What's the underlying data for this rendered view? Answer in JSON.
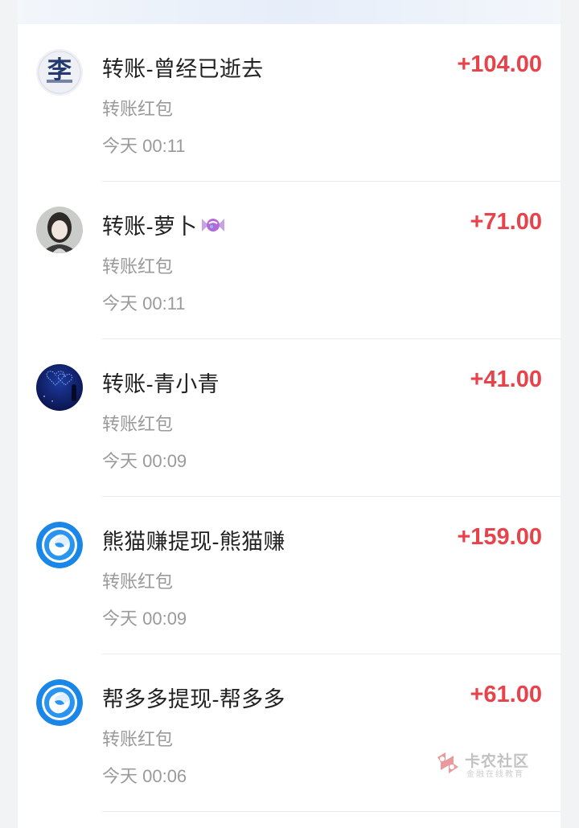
{
  "transactions": [
    {
      "title": "转账-曾经已逝去",
      "amount": "+104.00",
      "subtitle": "转账红包",
      "time": "今天 00:11",
      "avatar_icon": "li-character-avatar"
    },
    {
      "title": "转账-萝卜",
      "amount": "+71.00",
      "subtitle": "转账红包",
      "time": "今天 00:11",
      "avatar_icon": "girl-photo-avatar",
      "title_emoji": "candy-icon"
    },
    {
      "title": "转账-青小青",
      "amount": "+41.00",
      "subtitle": "转账红包",
      "time": "今天 00:09",
      "avatar_icon": "night-sky-avatar"
    },
    {
      "title": "熊猫赚提现-熊猫赚",
      "amount": "+159.00",
      "subtitle": "转账红包",
      "time": "今天 00:09",
      "avatar_icon": "blue-swirl-logo"
    },
    {
      "title": "帮多多提现-帮多多",
      "amount": "+61.00",
      "subtitle": "转账红包",
      "time": "今天 00:06",
      "avatar_icon": "blue-swirl-logo"
    }
  ],
  "watermark": {
    "title": "卡农社区",
    "subtitle": "金融在线教育"
  },
  "colors": {
    "amount": "#e8424b",
    "primary_text": "#222222",
    "secondary_text": "#9a9a9a",
    "logo_blue": "#1a86e8"
  }
}
